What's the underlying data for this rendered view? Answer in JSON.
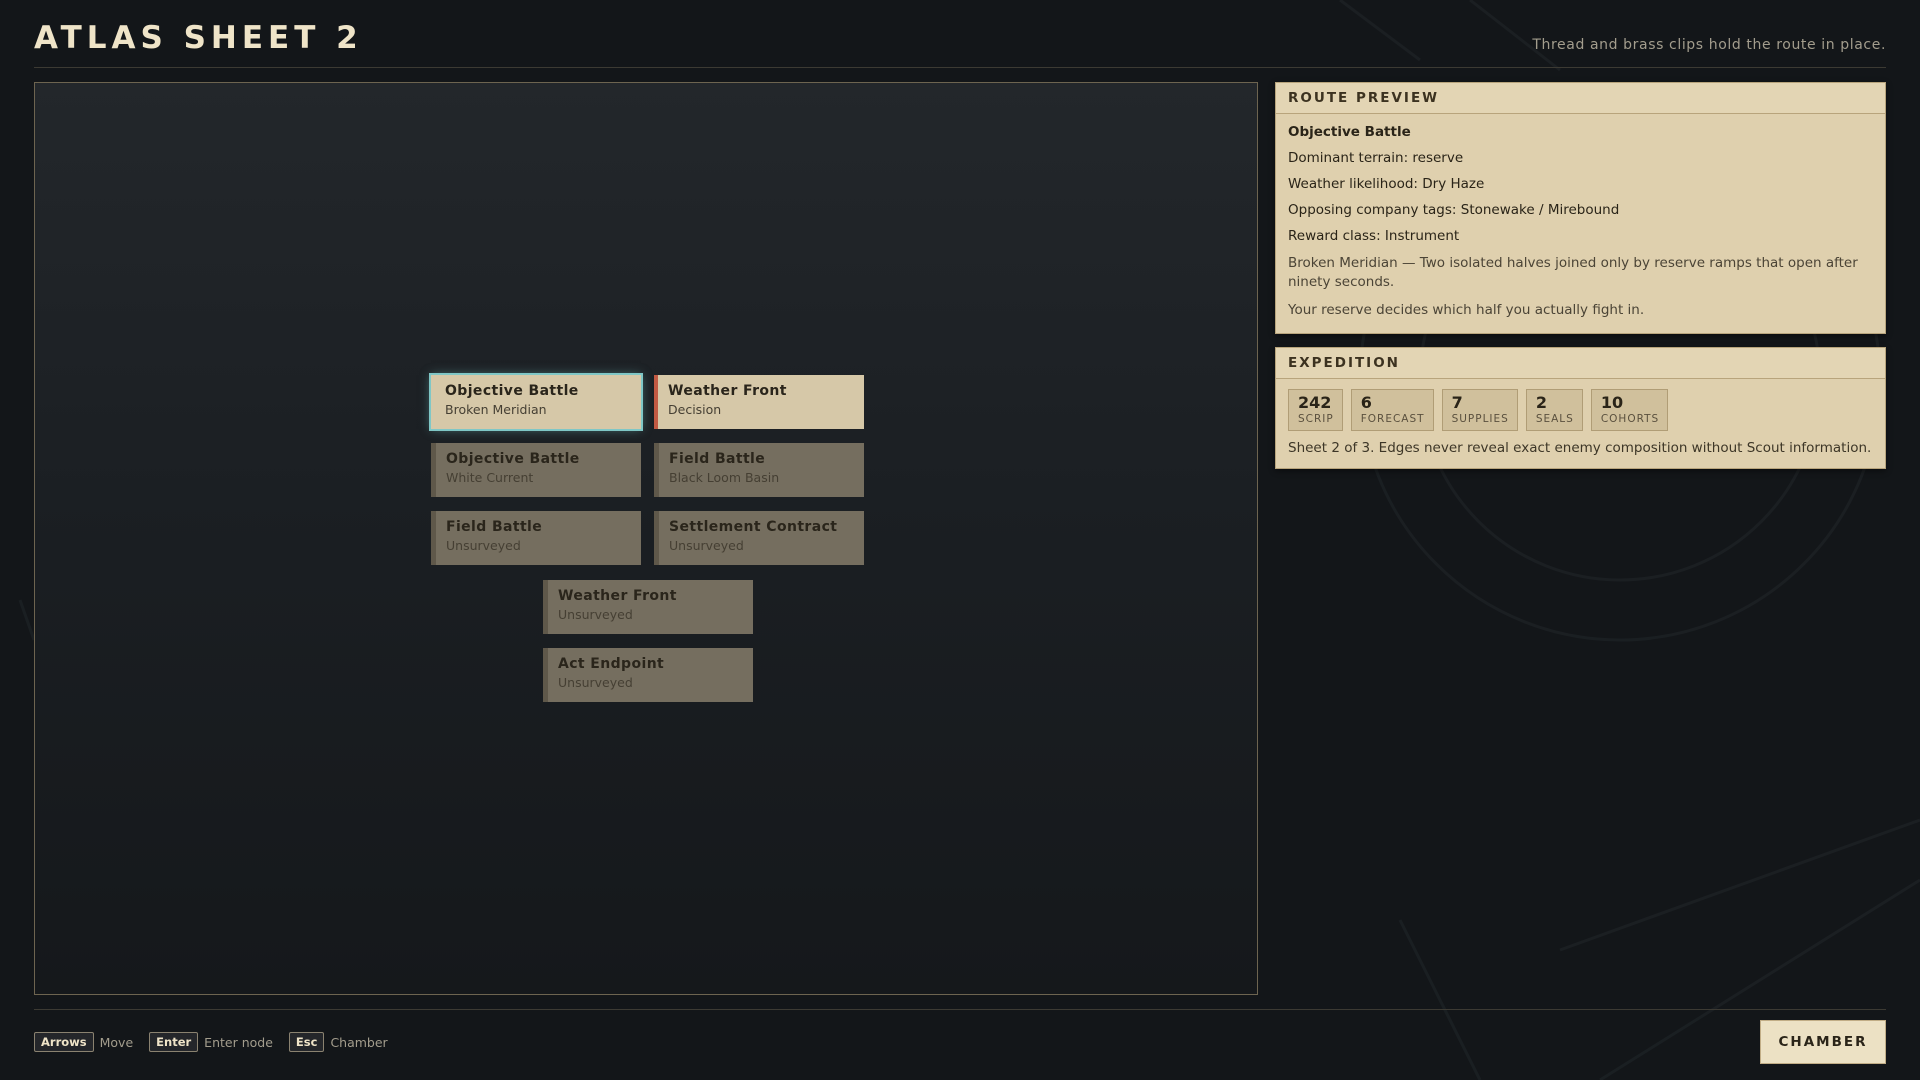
{
  "header": {
    "title": "ATLAS SHEET 2",
    "subtitle": "Thread and brass clips hold the route in place."
  },
  "map": {
    "nodes": [
      {
        "title": "Objective Battle",
        "subtitle": "Broken Meridian",
        "state": "selected"
      },
      {
        "title": "Weather Front",
        "subtitle": "Decision",
        "state": "decision"
      },
      {
        "title": "Objective Battle",
        "subtitle": "White Current",
        "state": "locked"
      },
      {
        "title": "Field Battle",
        "subtitle": "Black Loom Basin",
        "state": "locked"
      },
      {
        "title": "Field Battle",
        "subtitle": "Unsurveyed",
        "state": "locked"
      },
      {
        "title": "Settlement Contract",
        "subtitle": "Unsurveyed",
        "state": "locked"
      },
      {
        "title": "Weather Front",
        "subtitle": "Unsurveyed",
        "state": "locked"
      },
      {
        "title": "Act Endpoint",
        "subtitle": "Unsurveyed",
        "state": "locked"
      }
    ]
  },
  "route_preview": {
    "header": "ROUTE PREVIEW",
    "name": "Objective Battle",
    "terrain": "Dominant terrain: reserve",
    "weather": "Weather likelihood: Dry Haze",
    "tags": "Opposing company tags: Stonewake / Mirebound",
    "reward": "Reward class: Instrument",
    "description": "Broken Meridian — Two isolated halves joined only by reserve ramps that open after ninety seconds.",
    "note": "Your reserve decides which half you actually fight in."
  },
  "expedition": {
    "header": "EXPEDITION",
    "stats": [
      {
        "value": "242",
        "label": "SCRIP"
      },
      {
        "value": "6",
        "label": "FORECAST"
      },
      {
        "value": "7",
        "label": "SUPPLIES"
      },
      {
        "value": "2",
        "label": "SEALS"
      },
      {
        "value": "10",
        "label": "COHORTS"
      }
    ],
    "note": "Sheet 2 of 3. Edges never reveal exact enemy composition without Scout information."
  },
  "footer": {
    "hints": [
      {
        "key": "Arrows",
        "label": "Move"
      },
      {
        "key": "Enter",
        "label": "Enter node"
      },
      {
        "key": "Esc",
        "label": "Chamber"
      }
    ],
    "chamber_label": "CHAMBER"
  },
  "colors": {
    "parchment": "#dfd0ae",
    "node_locked": "#756e5f",
    "selected_glow": "#7fc7c6",
    "decision_accent": "#c25a43"
  }
}
